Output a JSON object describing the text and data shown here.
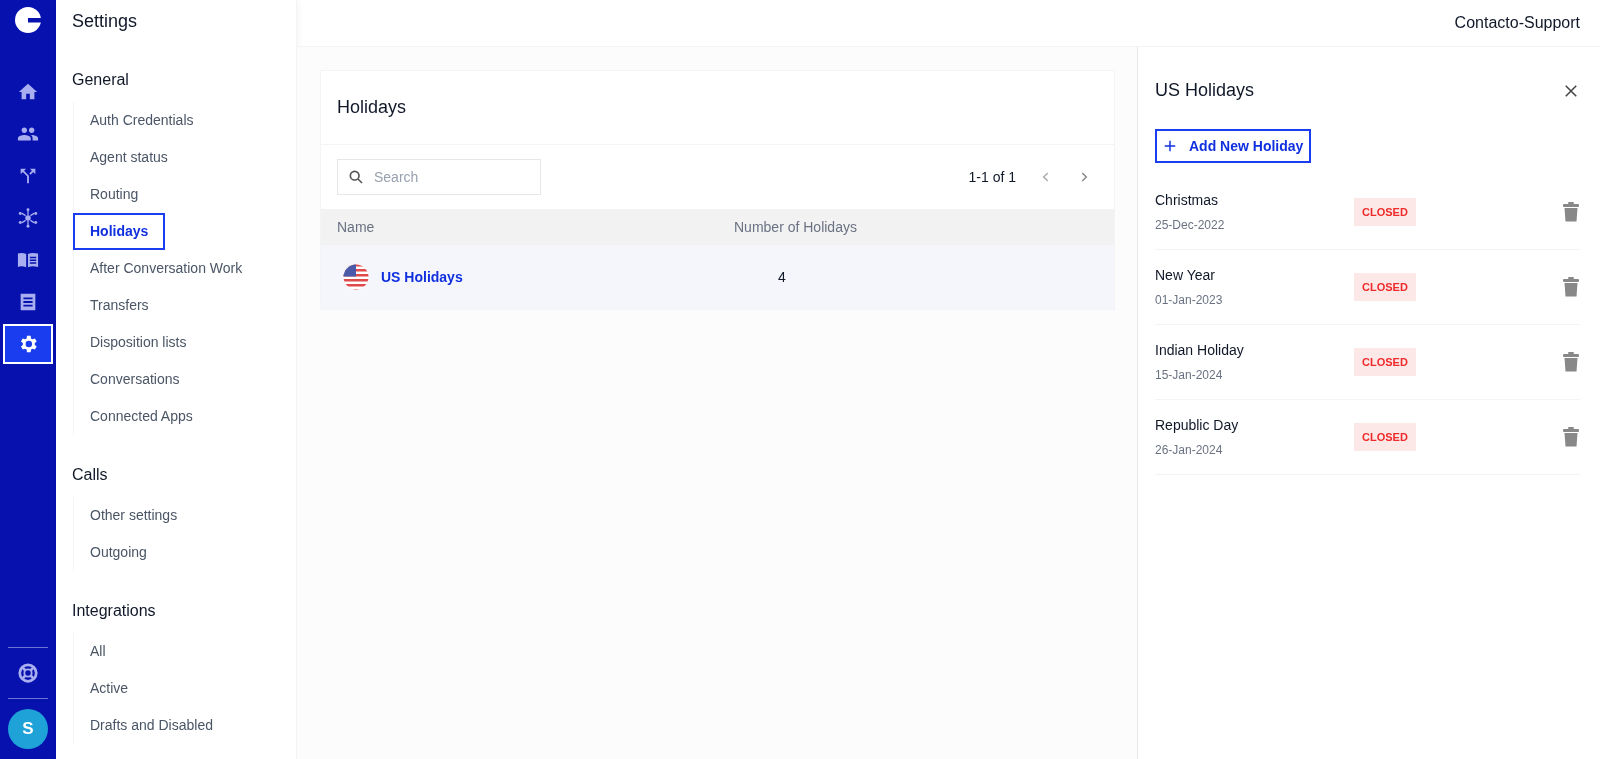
{
  "rail": {
    "items": [
      {
        "kind": "home",
        "selected": false
      },
      {
        "kind": "people",
        "selected": false
      },
      {
        "kind": "routing",
        "selected": false
      },
      {
        "kind": "hub",
        "selected": false
      },
      {
        "kind": "book",
        "selected": false
      },
      {
        "kind": "document",
        "selected": false
      },
      {
        "kind": "settings",
        "selected": true
      }
    ],
    "avatar": "S"
  },
  "sidebar": {
    "title": "Settings",
    "sections": [
      {
        "heading": "General",
        "items": [
          {
            "label": "Auth Credentials",
            "selected": false
          },
          {
            "label": "Agent status",
            "selected": false
          },
          {
            "label": "Routing",
            "selected": false
          },
          {
            "label": "Holidays",
            "selected": true
          },
          {
            "label": "After Conversation Work",
            "selected": false
          },
          {
            "label": "Transfers",
            "selected": false
          },
          {
            "label": "Disposition lists",
            "selected": false
          },
          {
            "label": "Conversations",
            "selected": false
          },
          {
            "label": "Connected Apps",
            "selected": false
          }
        ]
      },
      {
        "heading": "Calls",
        "items": [
          {
            "label": "Other settings",
            "selected": false
          },
          {
            "label": "Outgoing",
            "selected": false
          }
        ]
      },
      {
        "heading": "Integrations",
        "items": [
          {
            "label": "All",
            "selected": false
          },
          {
            "label": "Active",
            "selected": false
          },
          {
            "label": "Drafts and Disabled",
            "selected": false
          }
        ]
      }
    ]
  },
  "header": {
    "account": "Contacto-Support"
  },
  "holidays_card": {
    "title": "Holidays",
    "search": {
      "placeholder": "Search"
    },
    "pagination": "1-1 of 1",
    "table": {
      "columns": [
        "Name",
        "Number of Holidays"
      ],
      "rows": [
        {
          "name": "US Holidays",
          "count": "4"
        }
      ]
    }
  },
  "detail_panel": {
    "title": "US Holidays",
    "add_button": "Add New Holiday",
    "holidays": [
      {
        "name": "Christmas",
        "date": "25-Dec-2022",
        "status": "CLOSED"
      },
      {
        "name": "New Year",
        "date": "01-Jan-2023",
        "status": "CLOSED"
      },
      {
        "name": "Indian Holiday",
        "date": "15-Jan-2024",
        "status": "CLOSED"
      },
      {
        "name": "Republic Day",
        "date": "26-Jan-2024",
        "status": "CLOSED"
      }
    ]
  }
}
